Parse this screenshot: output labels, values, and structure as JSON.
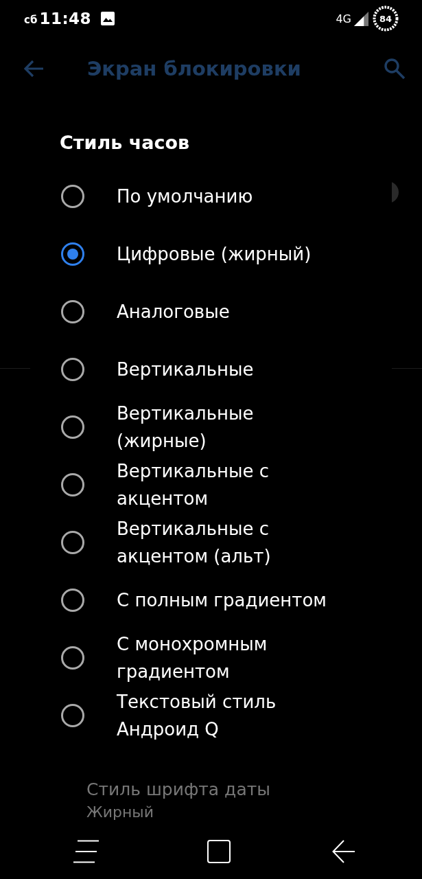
{
  "status_bar": {
    "day": "сб",
    "time": "11:48",
    "network": "4G",
    "battery": "84"
  },
  "app_bar": {
    "title": "Экран блокировки"
  },
  "dialog": {
    "title": "Стиль часов",
    "options": [
      {
        "label": "По умолчанию",
        "selected": false
      },
      {
        "label": "Цифровые (жирный)",
        "selected": true
      },
      {
        "label": "Аналоговые",
        "selected": false
      },
      {
        "label": "Вертикальные",
        "selected": false
      },
      {
        "label": "Вертикальные (жирные)",
        "selected": false
      },
      {
        "label": "Вертикальные с акцентом",
        "selected": false
      },
      {
        "label": "Вертикальные с акцентом (альт)",
        "selected": false
      },
      {
        "label": "С полным градиентом",
        "selected": false
      },
      {
        "label": "С монохромным градиентом",
        "selected": false
      },
      {
        "label": "Текстовый стиль Андроид Q",
        "selected": false
      }
    ]
  },
  "background_setting": {
    "title": "Стиль шрифта даты",
    "value": "Жирный"
  }
}
